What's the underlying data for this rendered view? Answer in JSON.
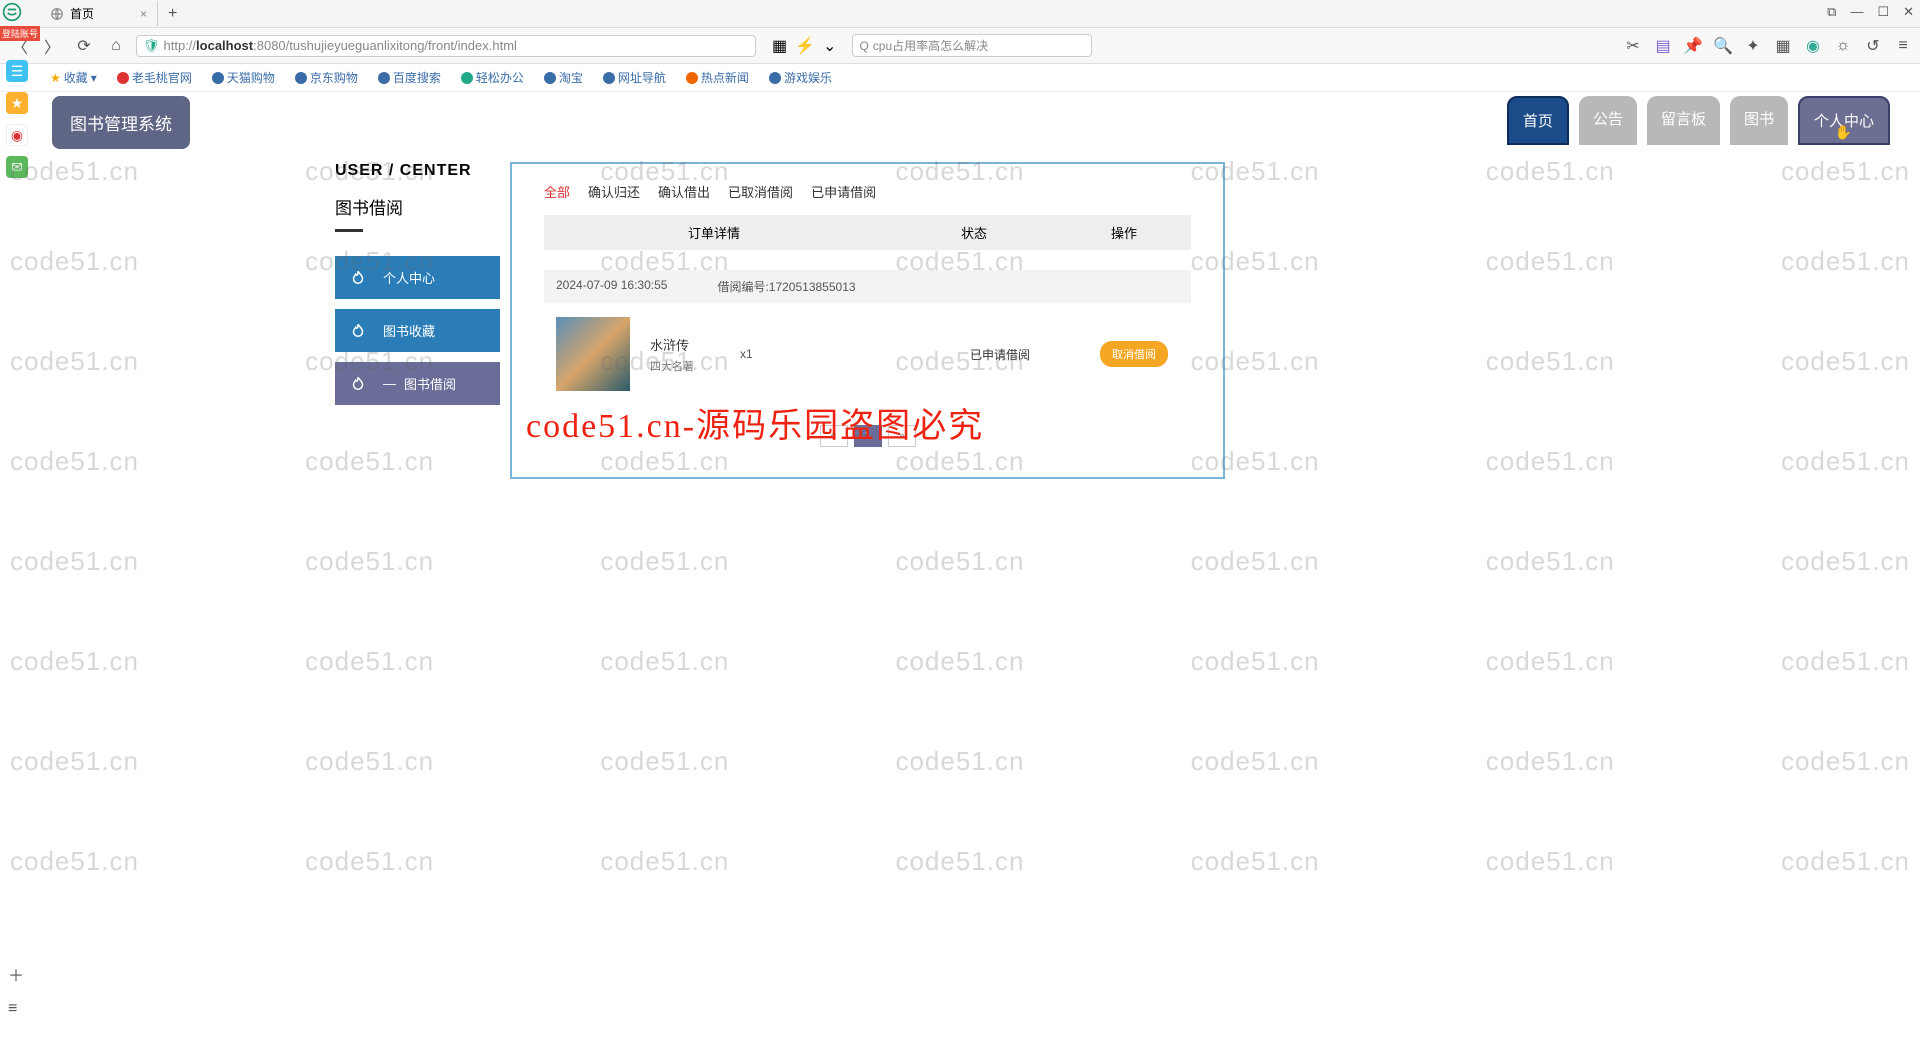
{
  "browser": {
    "red_tag": "登陆账号",
    "tab": {
      "title": "首页",
      "close": "×",
      "add": "+"
    },
    "url_prefix": "http://",
    "url_host": "localhost",
    "url_port_path": ":8080/tushujieyueguanlixitong/front/index.html",
    "search_text": "cpu占用率高怎么解决",
    "favorites_label": "收藏",
    "favorites": [
      "老毛桃官网",
      "天猫购物",
      "京东购物",
      "百度搜索",
      "轻松办公",
      "淘宝",
      "网址导航",
      "热点新闻",
      "游戏娱乐"
    ]
  },
  "logo": "图书管理系统",
  "nav": {
    "home": "首页",
    "notice": "公告",
    "board": "留言板",
    "book": "图书",
    "personal": "个人中心"
  },
  "uc": {
    "title": "USER / CENTER",
    "subtitle": "图书借阅",
    "menu": {
      "personal": "个人中心",
      "collect": "图书收藏",
      "borrow": "图书借阅"
    }
  },
  "tabs": {
    "all": "全部",
    "confirm_return": "确认归还",
    "confirm_out": "确认借出",
    "cancelled": "已取消借阅",
    "applied": "已申请借阅"
  },
  "table": {
    "head": {
      "detail": "订单详情",
      "status": "状态",
      "action": "操作"
    },
    "order": {
      "time": "2024-07-09 16:30:55",
      "id_label": "借阅编号:",
      "id": "1720513855013"
    },
    "row": {
      "title": "水浒传",
      "author": "四大名著",
      "qty": "x1",
      "status": "已申请借阅",
      "action": "取消借阅"
    }
  },
  "pager": {
    "prev": "«",
    "page": "1",
    "next": "»"
  },
  "overlay": "code51.cn-源码乐园盗图必究",
  "watermark": "code51.cn"
}
